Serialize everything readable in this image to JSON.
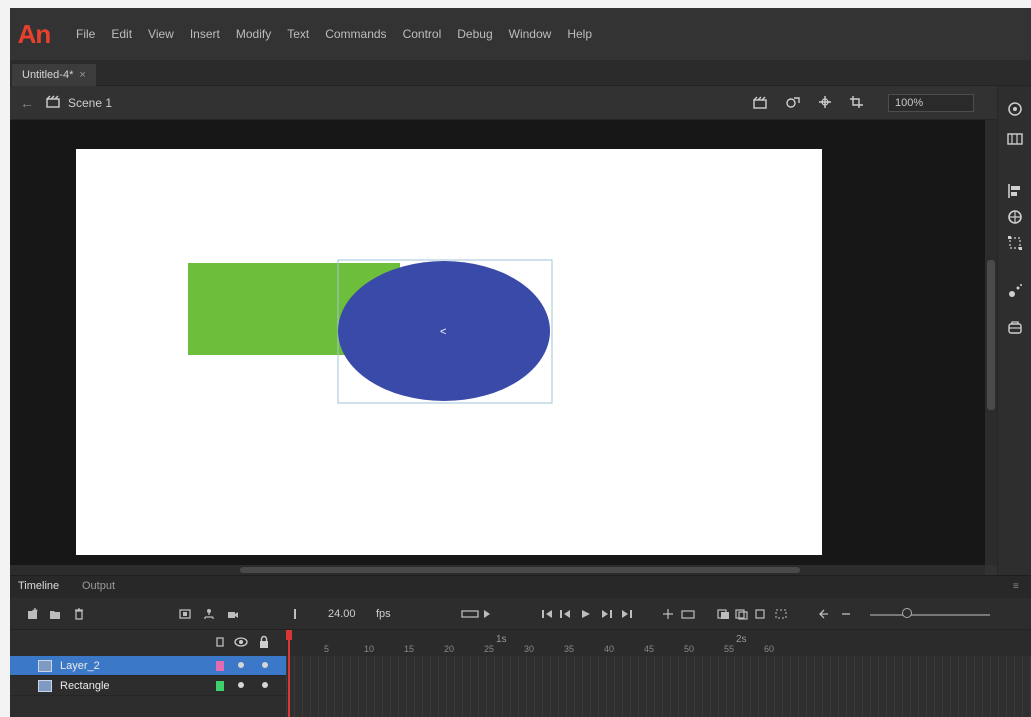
{
  "app": {
    "logo_text": "An",
    "menus": [
      "File",
      "Edit",
      "View",
      "Insert",
      "Modify",
      "Text",
      "Commands",
      "Control",
      "Debug",
      "Window",
      "Help"
    ]
  },
  "document": {
    "tab_title": "Untitled-4*",
    "tab_close": "×"
  },
  "editbar": {
    "back": "←",
    "scene_label": "Scene 1",
    "zoom": "100%"
  },
  "stage": {
    "background": "#ffffff",
    "shapes": [
      {
        "type": "rectangle",
        "name": "rectangle",
        "fill": "#6dbf3b"
      },
      {
        "type": "ellipse",
        "name": "ellipse",
        "fill": "#3a4aa8"
      }
    ],
    "cursor": "<"
  },
  "panel": {
    "tabs": [
      "Timeline",
      "Output"
    ],
    "fps": "24.00",
    "fps_unit": "fps",
    "ruler_labels": [
      "1s",
      "2s"
    ],
    "ruler_numbers": [
      "5",
      "10",
      "15",
      "20",
      "25",
      "30",
      "35",
      "40",
      "45",
      "50",
      "55",
      "60"
    ]
  },
  "layers": [
    {
      "name": "Layer_2",
      "selected": true,
      "color": "#e26bb4"
    },
    {
      "name": "Rectangle",
      "selected": false,
      "color": "#3fcf6b"
    }
  ],
  "colors": {
    "accent_red": "#e8402f",
    "selection_blue": "#3c78c8",
    "playhead": "#d93636"
  }
}
